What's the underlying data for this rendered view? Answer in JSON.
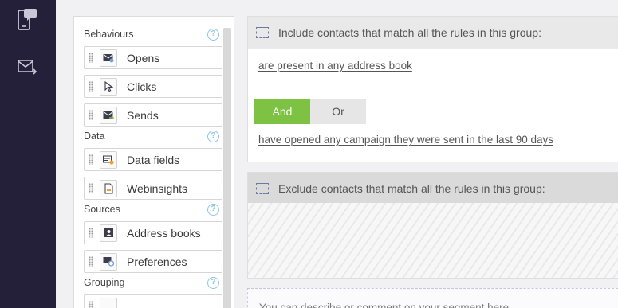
{
  "nav": {
    "items": [
      {
        "icon": "mobile-sms-icon"
      },
      {
        "icon": "email-send-icon"
      }
    ]
  },
  "palette": {
    "sections": [
      {
        "title": "Behaviours",
        "items": [
          {
            "label": "Opens",
            "icon": "email-open-icon"
          },
          {
            "label": "Clicks",
            "icon": "cursor-click-icon"
          },
          {
            "label": "Sends",
            "icon": "email-send-icon"
          }
        ]
      },
      {
        "title": "Data",
        "items": [
          {
            "label": "Data fields",
            "icon": "data-fields-icon"
          },
          {
            "label": "Webinsights",
            "icon": "document-icon"
          }
        ]
      },
      {
        "title": "Sources",
        "items": [
          {
            "label": "Address books",
            "icon": "address-book-icon"
          },
          {
            "label": "Preferences",
            "icon": "preferences-icon"
          }
        ]
      },
      {
        "title": "Grouping",
        "items": []
      }
    ],
    "help_glyph": "?"
  },
  "include_group": {
    "header": "Include contacts that match all the rules in this group:",
    "rule_1": "are present in any address book",
    "toggle_and": "And",
    "toggle_or": "Or",
    "rule_2": "have opened any campaign they were sent in the last 90 days"
  },
  "exclude_group": {
    "header": "Exclude contacts that match all the rules in this group:"
  },
  "comment": {
    "text": "You can describe or comment on your segment here"
  },
  "colors": {
    "nav_bg": "#24203a",
    "accent_green": "#7dc242",
    "help_blue": "#8cc5e6"
  }
}
